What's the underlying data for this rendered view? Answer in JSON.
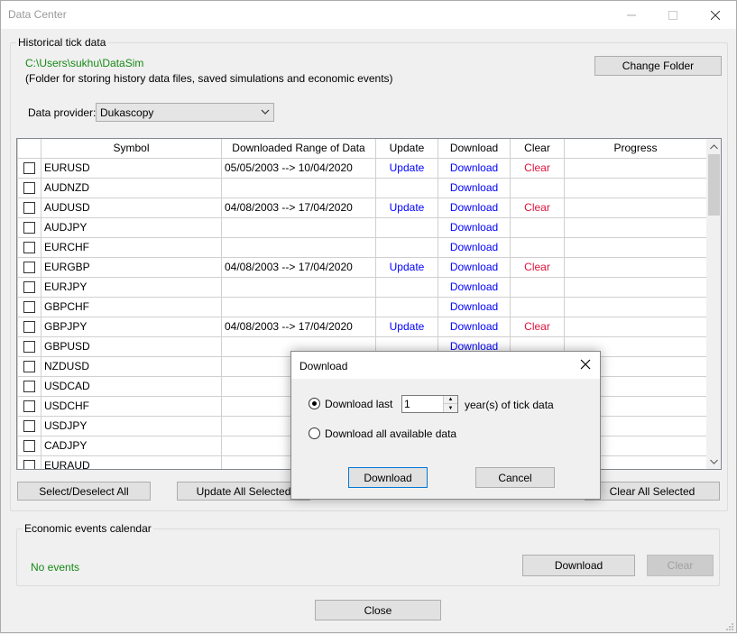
{
  "window": {
    "title": "Data Center"
  },
  "historical": {
    "legend": "Historical tick data",
    "path": "C:\\Users\\sukhu\\DataSim",
    "note": "(Folder for storing history data files, saved simulations and economic events)",
    "change_folder": "Change Folder",
    "provider_label": "Data provider:",
    "provider_value": "Dukascopy"
  },
  "grid": {
    "headers": [
      "Symbol",
      "Downloaded Range of Data",
      "Update",
      "Download",
      "Clear",
      "Progress"
    ],
    "rows": [
      {
        "symbol": "EURUSD",
        "range": "05/05/2003 --> 10/04/2020",
        "update": "Update",
        "download": "Download",
        "clear": "Clear"
      },
      {
        "symbol": "AUDNZD",
        "range": "",
        "update": "",
        "download": "Download",
        "clear": ""
      },
      {
        "symbol": "AUDUSD",
        "range": "04/08/2003 --> 17/04/2020",
        "update": "Update",
        "download": "Download",
        "clear": "Clear"
      },
      {
        "symbol": "AUDJPY",
        "range": "",
        "update": "",
        "download": "Download",
        "clear": ""
      },
      {
        "symbol": "EURCHF",
        "range": "",
        "update": "",
        "download": "Download",
        "clear": ""
      },
      {
        "symbol": "EURGBP",
        "range": "04/08/2003 --> 17/04/2020",
        "update": "Update",
        "download": "Download",
        "clear": "Clear"
      },
      {
        "symbol": "EURJPY",
        "range": "",
        "update": "",
        "download": "Download",
        "clear": ""
      },
      {
        "symbol": "GBPCHF",
        "range": "",
        "update": "",
        "download": "Download",
        "clear": ""
      },
      {
        "symbol": "GBPJPY",
        "range": "04/08/2003 --> 17/04/2020",
        "update": "Update",
        "download": "Download",
        "clear": "Clear"
      },
      {
        "symbol": "GBPUSD",
        "range": "",
        "update": "",
        "download": "Download",
        "clear": ""
      },
      {
        "symbol": "NZDUSD",
        "range": "",
        "update": "",
        "download": "",
        "clear": ""
      },
      {
        "symbol": "USDCAD",
        "range": "",
        "update": "",
        "download": "",
        "clear": ""
      },
      {
        "symbol": "USDCHF",
        "range": "",
        "update": "",
        "download": "",
        "clear": ""
      },
      {
        "symbol": "USDJPY",
        "range": "",
        "update": "",
        "download": "",
        "clear": ""
      },
      {
        "symbol": "CADJPY",
        "range": "",
        "update": "",
        "download": "",
        "clear": ""
      },
      {
        "symbol": "EURAUD",
        "range": "",
        "update": "",
        "download": "",
        "clear": ""
      }
    ]
  },
  "actions": {
    "select_all": "Select/Deselect All",
    "update_all": "Update All Selected",
    "clear_all": "Clear All Selected"
  },
  "economic": {
    "legend": "Economic events calendar",
    "status": "No events",
    "download": "Download",
    "clear": "Clear"
  },
  "footer": {
    "close": "Close"
  },
  "dialog": {
    "title": "Download",
    "option_last": "Download last",
    "years_value": "1",
    "years_suffix": "year(s) of tick data",
    "option_all": "Download all available data",
    "download": "Download",
    "cancel": "Cancel"
  },
  "colors": {
    "path_green": "#168916",
    "link_blue": "#0000ff",
    "link_red": "#dc143c"
  }
}
